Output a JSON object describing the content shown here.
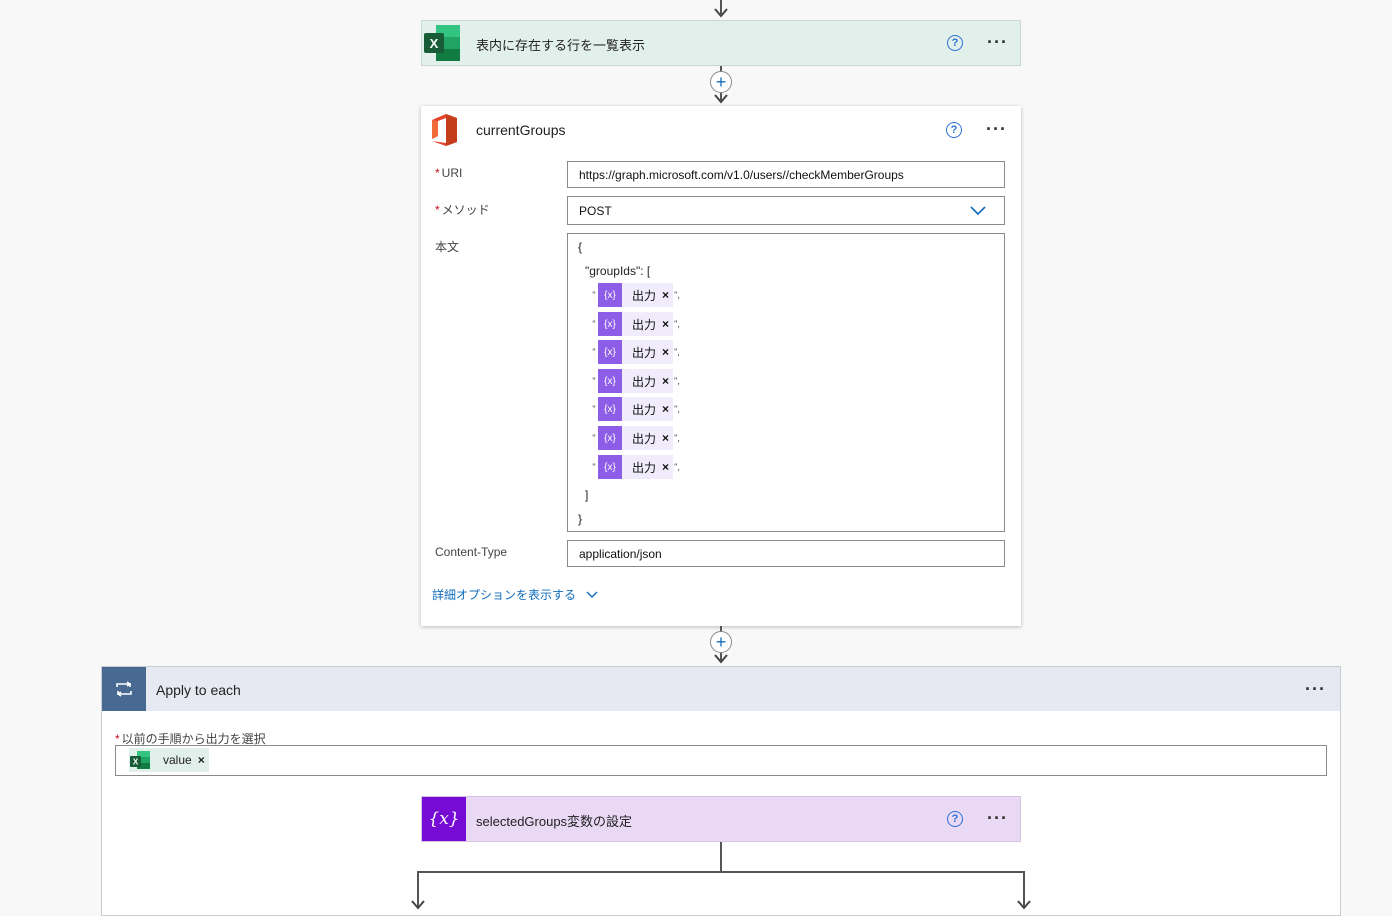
{
  "excel_action": {
    "title": "表内に存在する行を一覧表示",
    "help": "?",
    "more": "···"
  },
  "http_action": {
    "title": "currentGroups",
    "help": "?",
    "more": "···",
    "uri_label": "URI",
    "uri_value": "https://graph.microsoft.com/v1.0/users//checkMemberGroups",
    "method_label": "メソッド",
    "method_value": "POST",
    "body_label": "本文",
    "body_open": "{",
    "body_key": "\"groupIds\": [",
    "tokens": [
      {
        "label": "出力",
        "icon": "{x}",
        "remove": "×",
        "open_quote": "\"",
        "close_quote": "\","
      },
      {
        "label": "出力",
        "icon": "{x}",
        "remove": "×",
        "open_quote": "\"",
        "close_quote": "\","
      },
      {
        "label": "出力",
        "icon": "{x}",
        "remove": "×",
        "open_quote": "\"",
        "close_quote": "\","
      },
      {
        "label": "出力",
        "icon": "{x}",
        "remove": "×",
        "open_quote": "\"",
        "close_quote": "\","
      },
      {
        "label": "出力",
        "icon": "{x}",
        "remove": "×",
        "open_quote": "\"",
        "close_quote": "\","
      },
      {
        "label": "出力",
        "icon": "{x}",
        "remove": "×",
        "open_quote": "\"",
        "close_quote": "\","
      },
      {
        "label": "出力",
        "icon": "{x}",
        "remove": "×",
        "open_quote": "\"",
        "close_quote": "\","
      }
    ],
    "body_array_close": "]",
    "body_close": "}",
    "content_type_label": "Content-Type",
    "content_type_value": "application/json",
    "advanced_link": "詳細オプションを表示する"
  },
  "apply_each": {
    "title": "Apply to each",
    "more": "···",
    "select_label": "以前の手順から出力を選択",
    "token_label": "value",
    "token_remove": "×"
  },
  "variable_action": {
    "title": "selectedGroups変数の設定",
    "icon": "{x}",
    "help": "?",
    "more": "···"
  },
  "plus": "+",
  "colors": {
    "excel_header": "#e1f0ea",
    "apply_header": "#e6e9f1",
    "apply_icon_bg": "#486991",
    "variable_header": "#ead9f5",
    "variable_icon_bg": "#770bd6",
    "link": "#0f6cbd",
    "token_purple": "#8e5de8"
  }
}
